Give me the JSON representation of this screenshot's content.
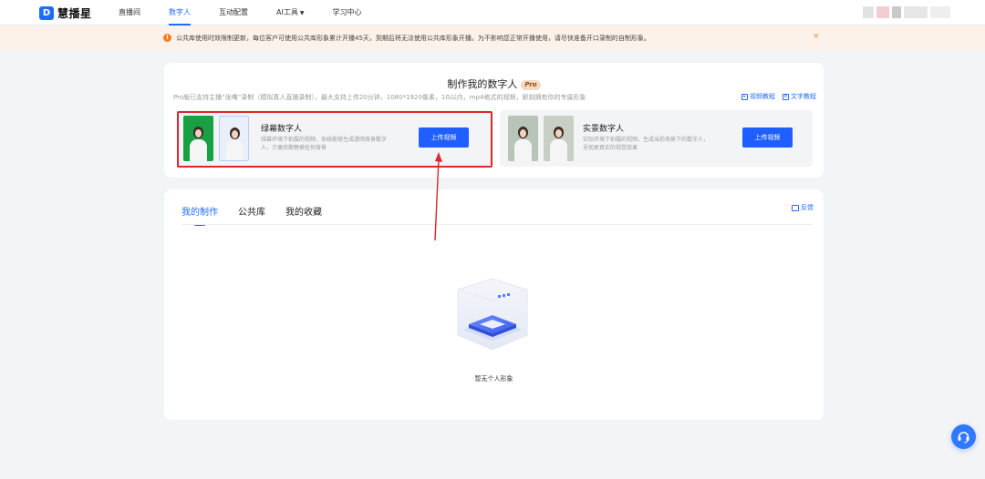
{
  "brand": {
    "name": "慧播星",
    "mark": "D"
  },
  "nav": {
    "items": [
      {
        "label": "直播间"
      },
      {
        "label": "数字人"
      },
      {
        "label": "互动配置"
      },
      {
        "label": "AI工具"
      },
      {
        "label": "学习中心"
      }
    ],
    "active": "数字人"
  },
  "notice": {
    "icon": "!",
    "text": "公共库使用时效限制更新，每位客户可使用公共库形象累计开播45天，到期后将无法使用公共库形象开播。为不影响您正常开播使用，请尽快准备开口录制的自制形象。",
    "close": "×"
  },
  "create": {
    "title": "制作我的数字人",
    "badge": "Pro",
    "description": "Pro版已支持主播“张嘴”录制（模拟真人直播录制），最大支持上传20分钟，1080*1920像素，1G以内，mp4格式的视频，即刻拥有你的专属形象",
    "tutorial_video": "视频教程",
    "tutorial_text": "文字教程",
    "options": [
      {
        "title": "绿幕数字人",
        "text": "绿幕环境下拍摄的视频，系统能够生成透明背景数字人，方便后期替换任何背景",
        "button": "上传视频"
      },
      {
        "title": "实景数字人",
        "text": "实际环境下拍摄的视频，生成当前场景下的数字人，呈现更真实的视觉效果",
        "button": "上传视频"
      }
    ]
  },
  "library": {
    "tabs": [
      {
        "label": "我的制作"
      },
      {
        "label": "公共库"
      },
      {
        "label": "我的收藏"
      }
    ],
    "active_tab": "我的制作",
    "feedback": "反馈",
    "empty_text": "暂无个人形象"
  },
  "colors": {
    "accent": "#1f6bff",
    "button": "#1f5eff",
    "notice_bg": "#fdf2e9",
    "notice_icon": "#f57c1f",
    "annotation_red": "#e0262a"
  }
}
